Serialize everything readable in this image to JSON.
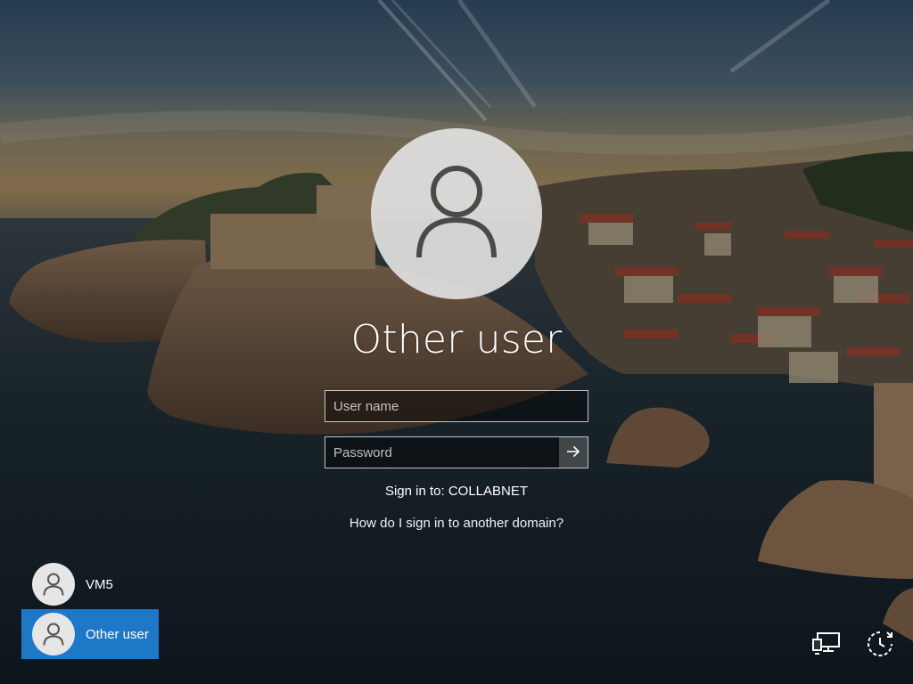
{
  "login": {
    "display_name": "Other user",
    "username_placeholder": "User name",
    "password_placeholder": "Password",
    "sign_in_to": "Sign in to: COLLABNET",
    "domain_help_link": "How do I sign in to another domain?"
  },
  "user_list": [
    {
      "label": "VM5",
      "selected": false
    },
    {
      "label": "Other user",
      "selected": true
    }
  ],
  "icons": {
    "large_avatar": "person-icon",
    "submit": "arrow-right-icon",
    "network": "network-icon",
    "accessibility": "ease-of-access-icon",
    "power": "power-icon"
  },
  "colors": {
    "selected_tile": "#1e78c8"
  }
}
